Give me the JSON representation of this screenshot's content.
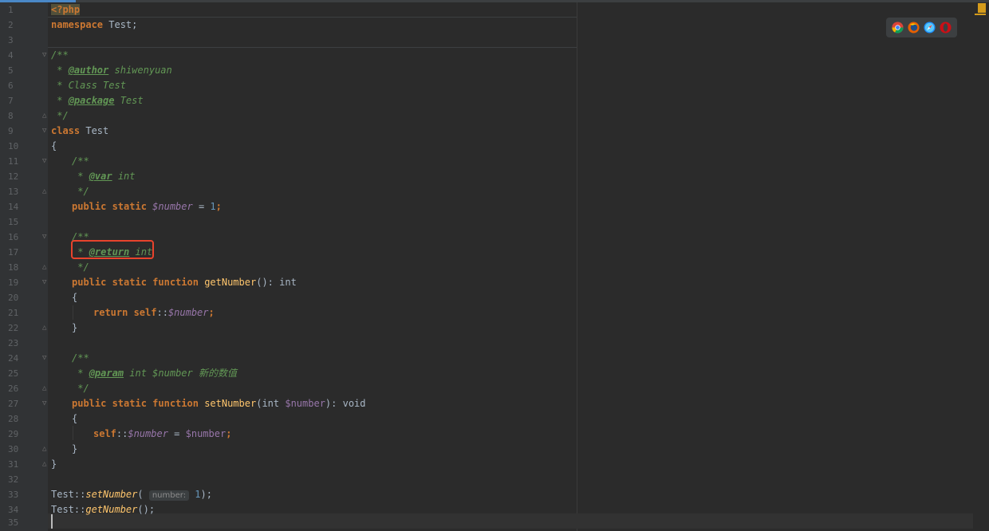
{
  "lines": [
    {
      "n": "1"
    },
    {
      "n": "2"
    },
    {
      "n": "3"
    },
    {
      "n": "4"
    },
    {
      "n": "5"
    },
    {
      "n": "6"
    },
    {
      "n": "7"
    },
    {
      "n": "8"
    },
    {
      "n": "9"
    },
    {
      "n": "10"
    },
    {
      "n": "11"
    },
    {
      "n": "12"
    },
    {
      "n": "13"
    },
    {
      "n": "14"
    },
    {
      "n": "15"
    },
    {
      "n": "16"
    },
    {
      "n": "17"
    },
    {
      "n": "18"
    },
    {
      "n": "19"
    },
    {
      "n": "20"
    },
    {
      "n": "21"
    },
    {
      "n": "22"
    },
    {
      "n": "23"
    },
    {
      "n": "24"
    },
    {
      "n": "25"
    },
    {
      "n": "26"
    },
    {
      "n": "27"
    },
    {
      "n": "28"
    },
    {
      "n": "29"
    },
    {
      "n": "30"
    },
    {
      "n": "31"
    },
    {
      "n": "32"
    },
    {
      "n": "33"
    },
    {
      "n": "34"
    },
    {
      "n": "35"
    }
  ],
  "code": {
    "l1_php": "<?php",
    "l2_kw": "namespace",
    "l2_rest": " Test;",
    "l4": "/**",
    "l5_star": " * ",
    "l5_tag": "@author",
    "l5_rest": " shiwenyuan",
    "l6": " * Class Test",
    "l7_star": " * ",
    "l7_tag": "@package",
    "l7_rest": " Test",
    "l8": " */",
    "l9_kw": "class",
    "l9_rest": " Test",
    "l10": "{",
    "l11": "/**",
    "l12_star": " * ",
    "l12_tag": "@var",
    "l12_rest": " int",
    "l13": " */",
    "l14_kw": "public static",
    "l14_var": "$number",
    "l14_eq": " = ",
    "l14_num": "1",
    "l14_end": ";",
    "l16": "/**",
    "l17_star": " * ",
    "l17_tag": "@return",
    "l17_rest": " int",
    "l18": " */",
    "l19_kw": "public static function",
    "l19_fn": "getNumber",
    "l19_rest": "(): int",
    "l20": "{",
    "l21_kw": "return self",
    "l21_sep": "::",
    "l21_var": "$number",
    "l21_end": ";",
    "l22": "}",
    "l24": "/**",
    "l25_star": " * ",
    "l25_tag": "@param",
    "l25_rest": " int $number 新的数值",
    "l26": " */",
    "l27_kw": "public static function",
    "l27_fn": "setNumber",
    "l27_p1": "(int ",
    "l27_var": "$number",
    "l27_p2": "): void",
    "l28": "{",
    "l29_kw": "self",
    "l29_sep": "::",
    "l29_var": "$number",
    "l29_eq": " = ",
    "l29_var2": "$number",
    "l29_end": ";",
    "l30": "}",
    "l31": "}",
    "l33_cls": "Test::",
    "l33_fn": "setNumber",
    "l33_open": "( ",
    "l33_hint": "number:",
    "l33_num": " 1",
    "l33_end": ");",
    "l34_cls": "Test::",
    "l34_fn": "getNumber",
    "l34_end": "();"
  },
  "browser_icons": [
    "chrome-icon",
    "firefox-icon",
    "safari-icon",
    "opera-icon"
  ],
  "colors": {
    "background": "#2b2b2b",
    "keyword": "#cc7832",
    "doc_comment": "#629755",
    "variable": "#9876aa",
    "function": "#ffc66d",
    "number": "#6897bb",
    "highlight_box": "#e8432c"
  }
}
